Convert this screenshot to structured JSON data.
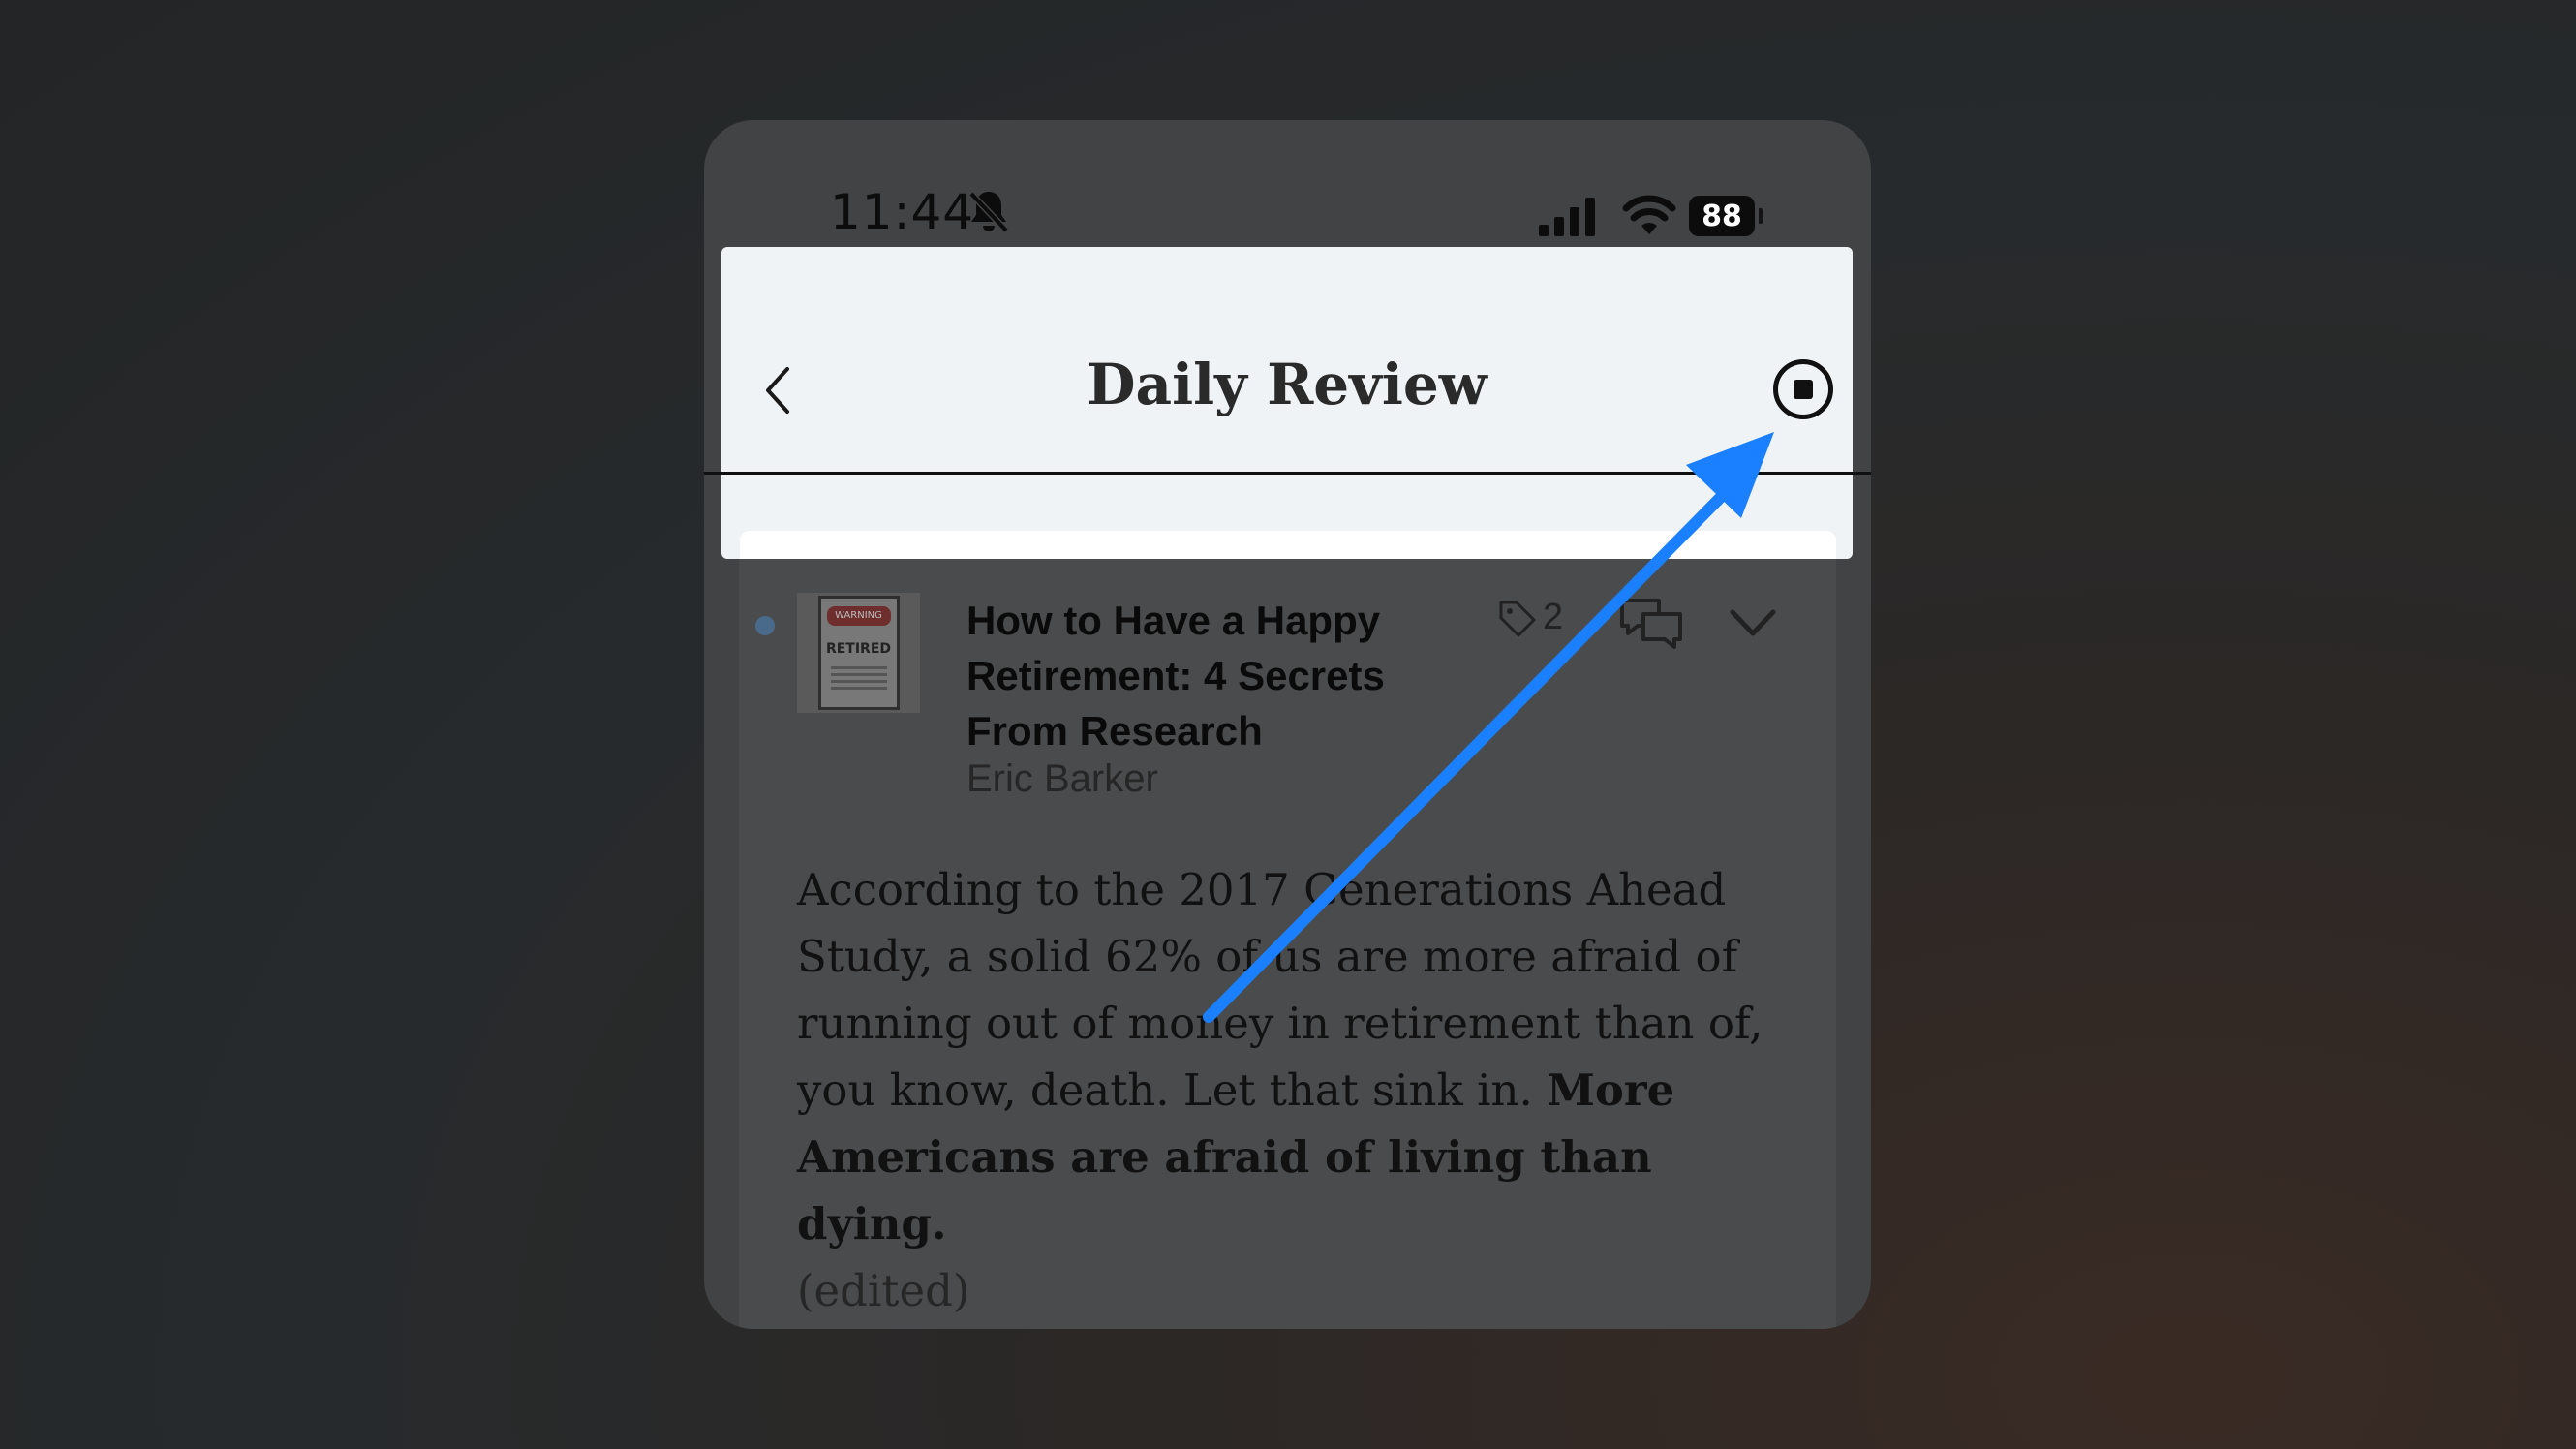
{
  "status_bar": {
    "time": "11:44",
    "battery": "88",
    "icons": [
      "bell-off-icon",
      "signal-icon",
      "wifi-icon",
      "battery-icon"
    ]
  },
  "header": {
    "title": "Daily Review",
    "back_icon": "chevron-left-icon",
    "stop_icon": "stop-circle-icon"
  },
  "card": {
    "document": {
      "title": "How to Have a Happy Retirement: 4 Secrets From Research",
      "author": "Eric Barker",
      "thumbnail": {
        "sign_header": "WARNING",
        "sign_text": "RETIRED"
      },
      "tag_count": "2"
    },
    "highlight": {
      "text": "According to the 2017 Generations Ahead Study, a solid 62% of us are more afraid of running out of money in retirement than of, you know, death. Let that sink in. ",
      "bold_text": "More Americans are afraid of living than dying.",
      "edited_label": "(edited)"
    }
  },
  "colors": {
    "accent_arrow": "#1a80ff",
    "header_background": "#f0f3f6",
    "unread_dot": "#4a6a8c"
  }
}
